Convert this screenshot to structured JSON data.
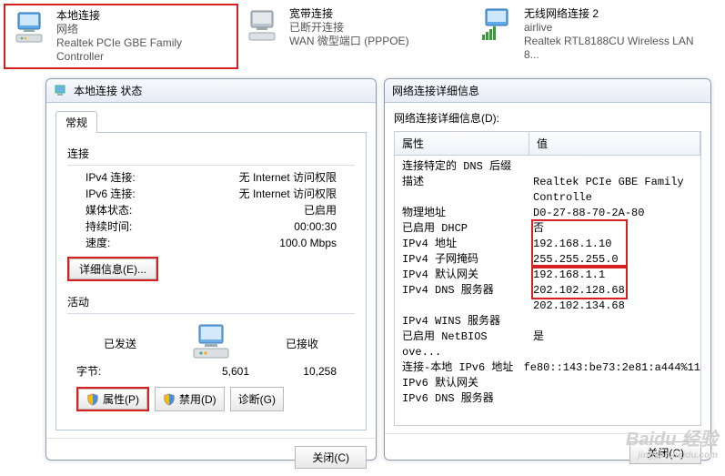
{
  "connections": [
    {
      "title": "本地连接",
      "line2": "网络",
      "line3": "Realtek PCIe GBE Family Controller",
      "highlighted": true
    },
    {
      "title": "宽带连接",
      "line2": "已断开连接",
      "line3": "WAN 微型端口 (PPPOE)",
      "highlighted": false
    },
    {
      "title": "无线网络连接 2",
      "line2": "airlive",
      "line3": "Realtek RTL8188CU Wireless LAN 8...",
      "highlighted": false
    }
  ],
  "status_window": {
    "title": "本地连接 状态",
    "tab": "常规",
    "section_connection": "连接",
    "rows": {
      "ipv4_label": "IPv4 连接:",
      "ipv4_value": "无 Internet 访问权限",
      "ipv6_label": "IPv6 连接:",
      "ipv6_value": "无 Internet 访问权限",
      "media_label": "媒体状态:",
      "media_value": "已启用",
      "duration_label": "持续时间:",
      "duration_value": "00:00:30",
      "speed_label": "速度:",
      "speed_value": "100.0 Mbps"
    },
    "details_btn": "详细信息(E)...",
    "section_activity": "活动",
    "sent_label": "已发送",
    "recv_label": "已接收",
    "bytes_label": "字节:",
    "sent_value": "5,601",
    "recv_value": "10,258",
    "btn_properties": "属性(P)",
    "btn_disable": "禁用(D)",
    "btn_diagnose": "诊断(G)",
    "btn_close": "关闭(C)"
  },
  "details_window": {
    "title": "网络连接详细信息",
    "subtitle": "网络连接详细信息(D):",
    "col_property": "属性",
    "col_value": "值",
    "rows": [
      {
        "p": "连接特定的 DNS 后缀",
        "v": ""
      },
      {
        "p": "描述",
        "v": "Realtek PCIe GBE Family Controlle"
      },
      {
        "p": "物理地址",
        "v": "D0-27-88-70-2A-80"
      },
      {
        "p": "已启用 DHCP",
        "v": "否"
      },
      {
        "p": "IPv4 地址",
        "v": "192.168.1.10"
      },
      {
        "p": "IPv4 子网掩码",
        "v": "255.255.255.0"
      },
      {
        "p": "IPv4 默认网关",
        "v": "192.168.1.1"
      },
      {
        "p": "IPv4 DNS 服务器",
        "v": "202.102.128.68"
      },
      {
        "p": "",
        "v": "202.102.134.68"
      },
      {
        "p": "IPv4 WINS 服务器",
        "v": ""
      },
      {
        "p": "已启用 NetBIOS ove...",
        "v": "是"
      },
      {
        "p": "连接-本地 IPv6 地址",
        "v": "fe80::143:be73:2e81:a444%11"
      },
      {
        "p": "IPv6 默认网关",
        "v": ""
      },
      {
        "p": "IPv6 DNS 服务器",
        "v": ""
      }
    ],
    "btn_close": "关闭(C)"
  },
  "watermark": {
    "brand": "Baidu 经验",
    "url": "jingyan.baidu.com"
  }
}
